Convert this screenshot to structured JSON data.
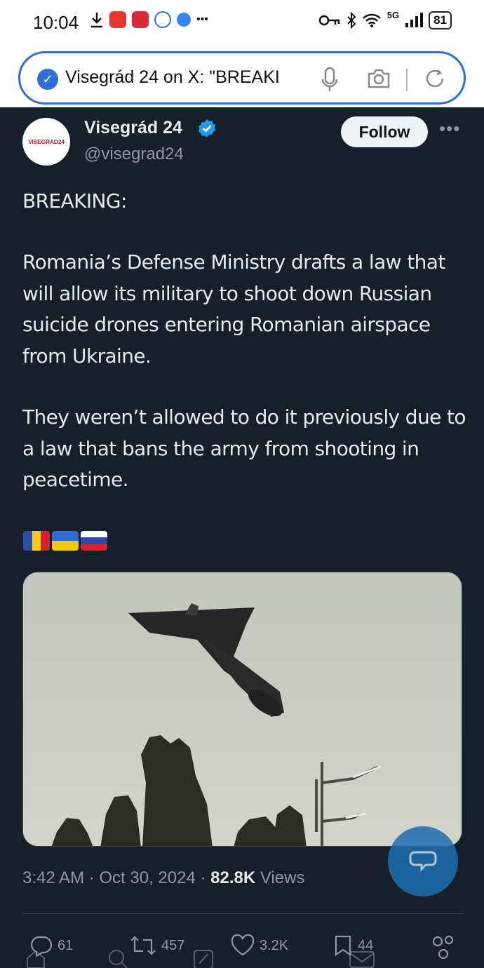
{
  "status_bar": {
    "time": "10:04",
    "network": "5G",
    "battery": "81"
  },
  "browser": {
    "url_text": "Visegrád 24 on X: \"BREAKI"
  },
  "tweet": {
    "avatar_text": "VISEGRAD24",
    "display_name": "Visegrád 24",
    "handle": "@visegrad24",
    "follow_label": "Follow",
    "more_label": "•••",
    "paragraphs": [
      "BREAKING:",
      "Romania’s Defense Ministry drafts a law that will allow its military to shoot down Russian suicide drones entering Romanian airspace from Ukraine.",
      "They weren’t allowed to do it previously due to a law that bans the army from shooting in peacetime."
    ],
    "flags": [
      "romania-flag",
      "ukraine-flag",
      "russia-flag"
    ],
    "timestamp": "3:42 AM · Oct 30, 2024 · ",
    "views_count": "82.8K",
    "views_label": " Views",
    "actions": {
      "replies": "61",
      "reposts": "457",
      "likes": "3.2K",
      "bookmarks": "44"
    }
  },
  "colors": {
    "background": "#15202b",
    "text": "#e7e9ea",
    "secondary_text": "#8b98a5",
    "verified": "#1d9bf0",
    "url_border": "#2f6fd6"
  }
}
